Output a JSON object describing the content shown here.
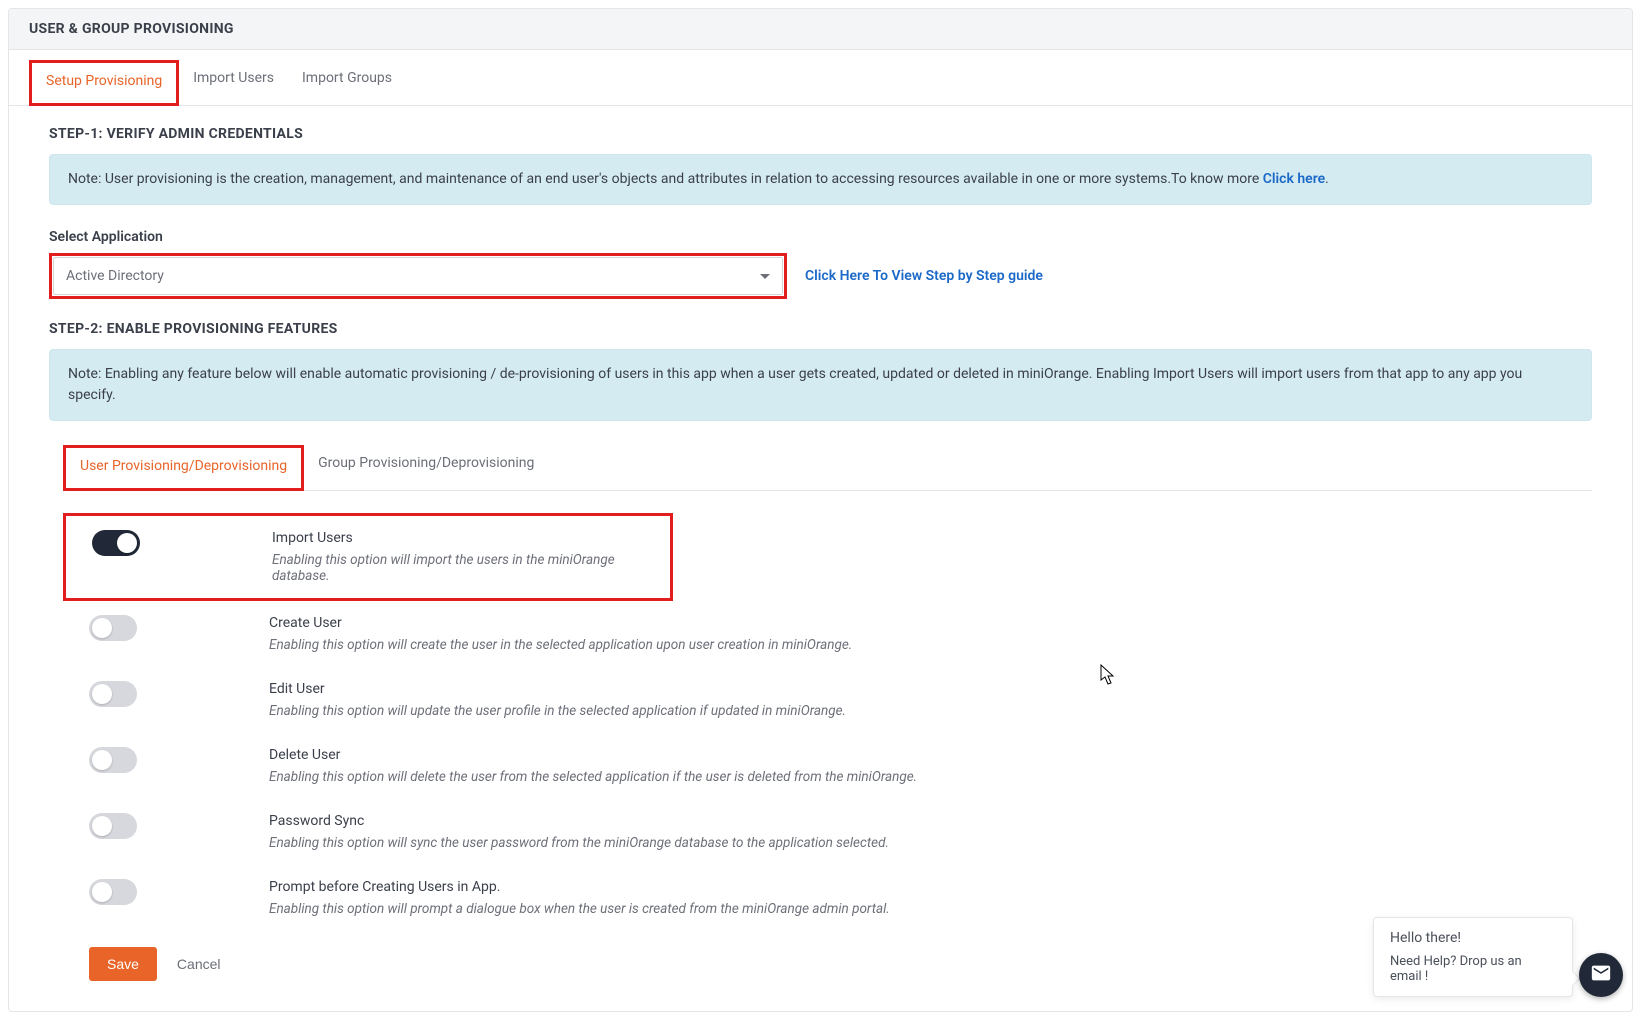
{
  "header": {
    "title": "USER & GROUP PROVISIONING"
  },
  "mainTabs": {
    "active": "Setup Provisioning",
    "items": [
      "Setup Provisioning",
      "Import Users",
      "Import Groups"
    ]
  },
  "step1": {
    "heading": "STEP-1: VERIFY ADMIN CREDENTIALS",
    "note_prefix": "Note: User provisioning is the creation, management, and maintenance of an end user's objects and attributes in relation to accessing resources available in one or more systems.To know more ",
    "note_link": "Click here",
    "note_suffix": ".",
    "select_label": "Select Application",
    "select_value": "Active Directory",
    "guide_link": "Click Here To View Step by Step guide"
  },
  "step2": {
    "heading": "STEP-2: ENABLE PROVISIONING FEATURES",
    "note": "Note: Enabling any feature below will enable automatic provisioning / de-provisioning of users in this app when a user gets created, updated or deleted in miniOrange. Enabling Import Users will import users from that app to any app you specify.",
    "subTabs": {
      "active": "User Provisioning/Deprovisioning",
      "items": [
        "User Provisioning/Deprovisioning",
        "Group Provisioning/Deprovisioning"
      ]
    },
    "features": [
      {
        "enabled": true,
        "highlight": true,
        "title": "Import Users",
        "desc": "Enabling this option will import the users in the miniOrange database."
      },
      {
        "enabled": false,
        "highlight": false,
        "title": "Create User",
        "desc": "Enabling this option will create the user in the selected application upon user creation in miniOrange."
      },
      {
        "enabled": false,
        "highlight": false,
        "title": "Edit User",
        "desc": "Enabling this option will update the user profile in the selected application if updated in miniOrange."
      },
      {
        "enabled": false,
        "highlight": false,
        "title": "Delete User",
        "desc": "Enabling this option will delete the user from the selected application if the user is deleted from the miniOrange."
      },
      {
        "enabled": false,
        "highlight": false,
        "title": "Password Sync",
        "desc": "Enabling this option will sync the user password from the miniOrange database to the application selected."
      },
      {
        "enabled": false,
        "highlight": false,
        "title": "Prompt before Creating Users in App.",
        "desc": "Enabling this option will prompt a dialogue box when the user is created from the miniOrange admin portal."
      }
    ]
  },
  "actions": {
    "save": "Save",
    "cancel": "Cancel"
  },
  "help": {
    "line1": "Hello there!",
    "line2": "Need Help? Drop us an email !"
  }
}
